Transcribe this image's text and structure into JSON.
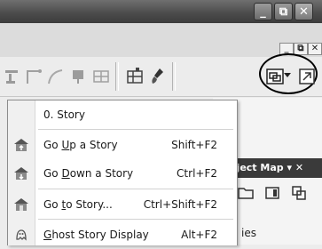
{
  "window": {
    "minimize_label": "_",
    "restore_label": "⧉",
    "close_label": "✕"
  },
  "mdi": {
    "minimize_label": "_",
    "restore_label": "⧉",
    "close_label": "✕"
  },
  "toolbar": {
    "tools": [
      "stair-tool-icon",
      "wall-corner-icon",
      "arc-tool-icon",
      "push-pin-icon",
      "grid-tool-icon",
      "table-tool-icon",
      "brush-tool-icon",
      "story-button-icon",
      "story-dropdown-arrow-icon",
      "next-tool-icon"
    ]
  },
  "menu": {
    "items": [
      {
        "label": "0. Story",
        "shortcut": ""
      },
      {
        "label": "Go Up a Story",
        "shortcut": "Shift+F2",
        "icon": "go-up-story-icon"
      },
      {
        "label": "Go Down a Story",
        "shortcut": "Ctrl+F2",
        "icon": "go-down-story-icon"
      },
      {
        "label": "Go to Story...",
        "shortcut": "Ctrl+Shift+F2",
        "icon": "go-to-story-icon"
      },
      {
        "label": "Ghost Story Display",
        "shortcut": "Alt+F2",
        "icon": "ghost-story-icon"
      }
    ]
  },
  "panel": {
    "title": "oject Map ▾ ✕",
    "partial_text": "ies"
  }
}
